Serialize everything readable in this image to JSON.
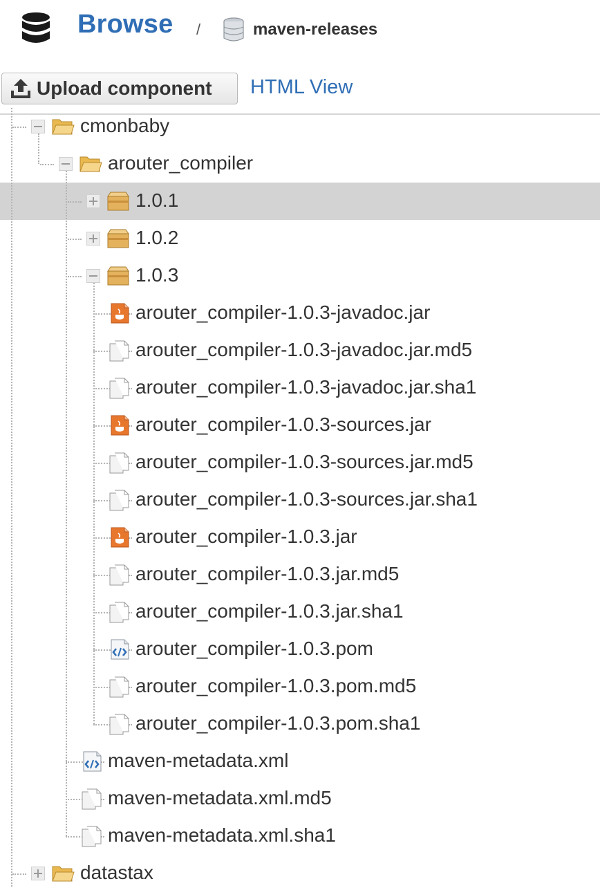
{
  "header": {
    "title": "Browse",
    "separator": "/",
    "repository": "maven-releases"
  },
  "toolbar": {
    "upload_label": "Upload component",
    "html_view_label": "HTML View"
  },
  "tree": {
    "nodes": [
      {
        "label": "cmonbaby",
        "icon": "folder-open-icon",
        "state": "expanded",
        "selected": false
      },
      {
        "label": "arouter_compiler",
        "icon": "folder-open-icon",
        "state": "expanded",
        "selected": false
      },
      {
        "label": "1.0.1",
        "icon": "package-icon",
        "state": "collapsed",
        "selected": true
      },
      {
        "label": "1.0.2",
        "icon": "package-icon",
        "state": "collapsed",
        "selected": false
      },
      {
        "label": "1.0.3",
        "icon": "package-icon",
        "state": "expanded",
        "selected": false
      },
      {
        "label": "arouter_compiler-1.0.3-javadoc.jar",
        "icon": "jar-file-icon",
        "state": "leaf",
        "selected": false
      },
      {
        "label": "arouter_compiler-1.0.3-javadoc.jar.md5",
        "icon": "generic-file-icon",
        "state": "leaf",
        "selected": false
      },
      {
        "label": "arouter_compiler-1.0.3-javadoc.jar.sha1",
        "icon": "generic-file-icon",
        "state": "leaf",
        "selected": false
      },
      {
        "label": "arouter_compiler-1.0.3-sources.jar",
        "icon": "jar-file-icon",
        "state": "leaf",
        "selected": false
      },
      {
        "label": "arouter_compiler-1.0.3-sources.jar.md5",
        "icon": "generic-file-icon",
        "state": "leaf",
        "selected": false
      },
      {
        "label": "arouter_compiler-1.0.3-sources.jar.sha1",
        "icon": "generic-file-icon",
        "state": "leaf",
        "selected": false
      },
      {
        "label": "arouter_compiler-1.0.3.jar",
        "icon": "jar-file-icon",
        "state": "leaf",
        "selected": false
      },
      {
        "label": "arouter_compiler-1.0.3.jar.md5",
        "icon": "generic-file-icon",
        "state": "leaf",
        "selected": false
      },
      {
        "label": "arouter_compiler-1.0.3.jar.sha1",
        "icon": "generic-file-icon",
        "state": "leaf",
        "selected": false
      },
      {
        "label": "arouter_compiler-1.0.3.pom",
        "icon": "xml-file-icon",
        "state": "leaf",
        "selected": false
      },
      {
        "label": "arouter_compiler-1.0.3.pom.md5",
        "icon": "generic-file-icon",
        "state": "leaf",
        "selected": false
      },
      {
        "label": "arouter_compiler-1.0.3.pom.sha1",
        "icon": "generic-file-icon",
        "state": "leaf",
        "selected": false
      },
      {
        "label": "maven-metadata.xml",
        "icon": "xml-file-icon",
        "state": "leaf",
        "selected": false
      },
      {
        "label": "maven-metadata.xml.md5",
        "icon": "generic-file-icon",
        "state": "leaf",
        "selected": false
      },
      {
        "label": "maven-metadata.xml.sha1",
        "icon": "generic-file-icon",
        "state": "leaf",
        "selected": false
      },
      {
        "label": "datastax",
        "icon": "folder-icon",
        "state": "collapsed",
        "selected": false
      }
    ]
  },
  "colors": {
    "link": "#2f6eb5",
    "selected_row": "#d3d3d3",
    "jar_orange": "#e8772e",
    "folder_yellow": "#f0c86a"
  }
}
